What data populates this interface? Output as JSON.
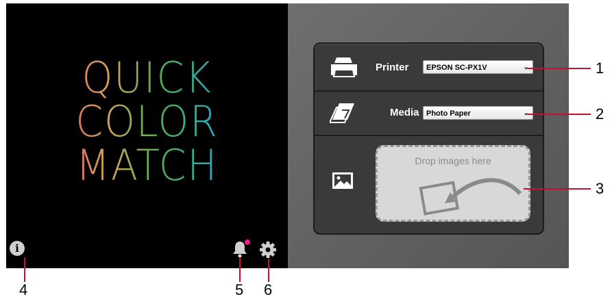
{
  "logo": {
    "line1": "QUICK",
    "line2": "COLOR",
    "line3": "MATCH"
  },
  "icons": {
    "info": "info-icon",
    "notifications": "bell-icon",
    "settings": "gear-icon",
    "printer": "printer-icon",
    "media": "paper-icon",
    "image": "image-icon",
    "drop_illustration": "drop-arrow-icon"
  },
  "info_glyph": "i",
  "printer": {
    "label": "Printer",
    "selected": "EPSON SC-PX1V"
  },
  "media": {
    "label": "Media",
    "selected": "Photo Paper"
  },
  "drop_zone": {
    "text": "Drop images here"
  },
  "callouts": [
    "1",
    "2",
    "3",
    "4",
    "5",
    "6"
  ],
  "colors": {
    "callout_red": "#c8102e",
    "notification_dot": "#e91e8c",
    "panel_dark": "#3a3a3a",
    "panel_gray": "#606060"
  }
}
